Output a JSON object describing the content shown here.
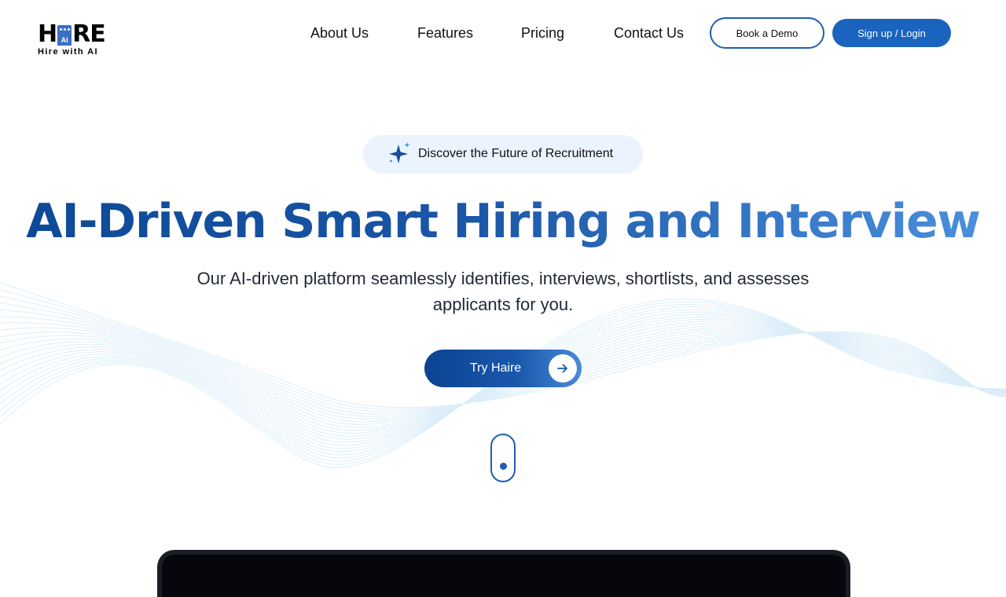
{
  "logo": {
    "letters_left": "H",
    "ai_mark": "AI",
    "letters_right": "RE",
    "tagline": "Hire with AI"
  },
  "nav": {
    "items": [
      "About Us",
      "Features",
      "Pricing",
      "Contact Us"
    ]
  },
  "header": {
    "book_demo_label": "Book a Demo",
    "signup_label": "Sign up / Login"
  },
  "hero": {
    "badge_icon": "sparkle-icon",
    "badge_text": "Discover the Future of Recruitment",
    "headline": "AI-Driven Smart Hiring and Interview",
    "subheadline": "Our AI-driven platform seamlessly identifies, interviews, shortlists, and assesses applicants for you.",
    "cta_label": "Try Haire",
    "cta_icon": "arrow-right-icon",
    "scroll_icon": "scroll-indicator-icon"
  },
  "colors": {
    "primary": "#1a63bf",
    "primary_dark": "#0b4391",
    "accent_light": "#4a8ad8",
    "badge_bg": "#eaf3fe",
    "wave": "#bfe0f5"
  }
}
